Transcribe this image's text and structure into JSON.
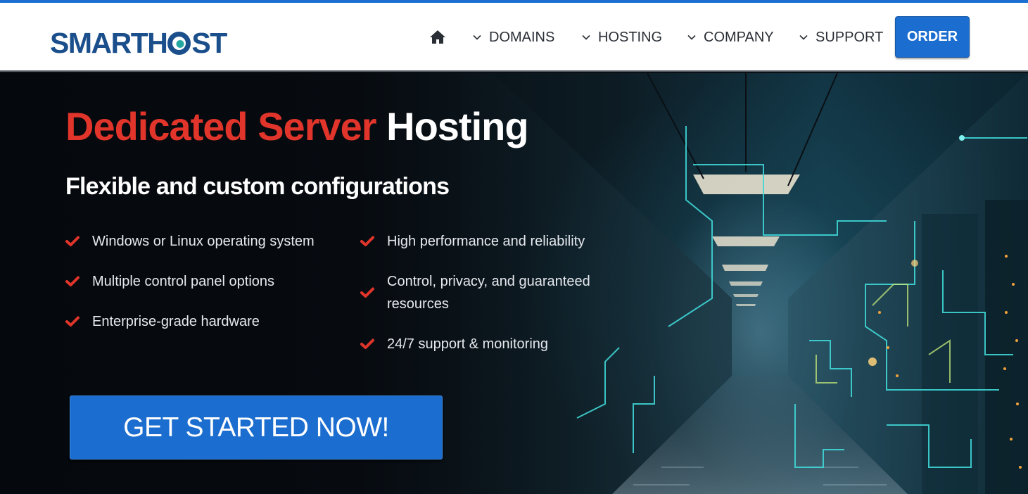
{
  "header": {
    "logo_text_left": "SMARTH",
    "logo_text_right": "ST",
    "nav": [
      {
        "label": "DOMAINS"
      },
      {
        "label": "HOSTING"
      },
      {
        "label": "COMPANY"
      },
      {
        "label": "SUPPORT"
      }
    ],
    "order_label": "ORDER"
  },
  "hero": {
    "title_red": "Dedicated Server",
    "title_white": "Hosting",
    "subtitle": "Flexible and custom configurations",
    "features_left": [
      "Windows or Linux operating system",
      "Multiple control panel options",
      "Enterprise-grade hardware"
    ],
    "features_right": [
      "High performance and reliability",
      "Control, privacy, and guaranteed",
      "resources",
      "24/7 support & monitoring"
    ],
    "cta_label": "GET STARTED NOW!"
  },
  "colors": {
    "accent_blue": "#1b6dcf",
    "title_red": "#e1352b",
    "logo_navy": "#1b4f8c",
    "logo_teal": "#22a8a0",
    "circuit_cyan": "#3fd6d6"
  },
  "icons": [
    "home-icon",
    "chevron-down-icon",
    "check-icon"
  ]
}
